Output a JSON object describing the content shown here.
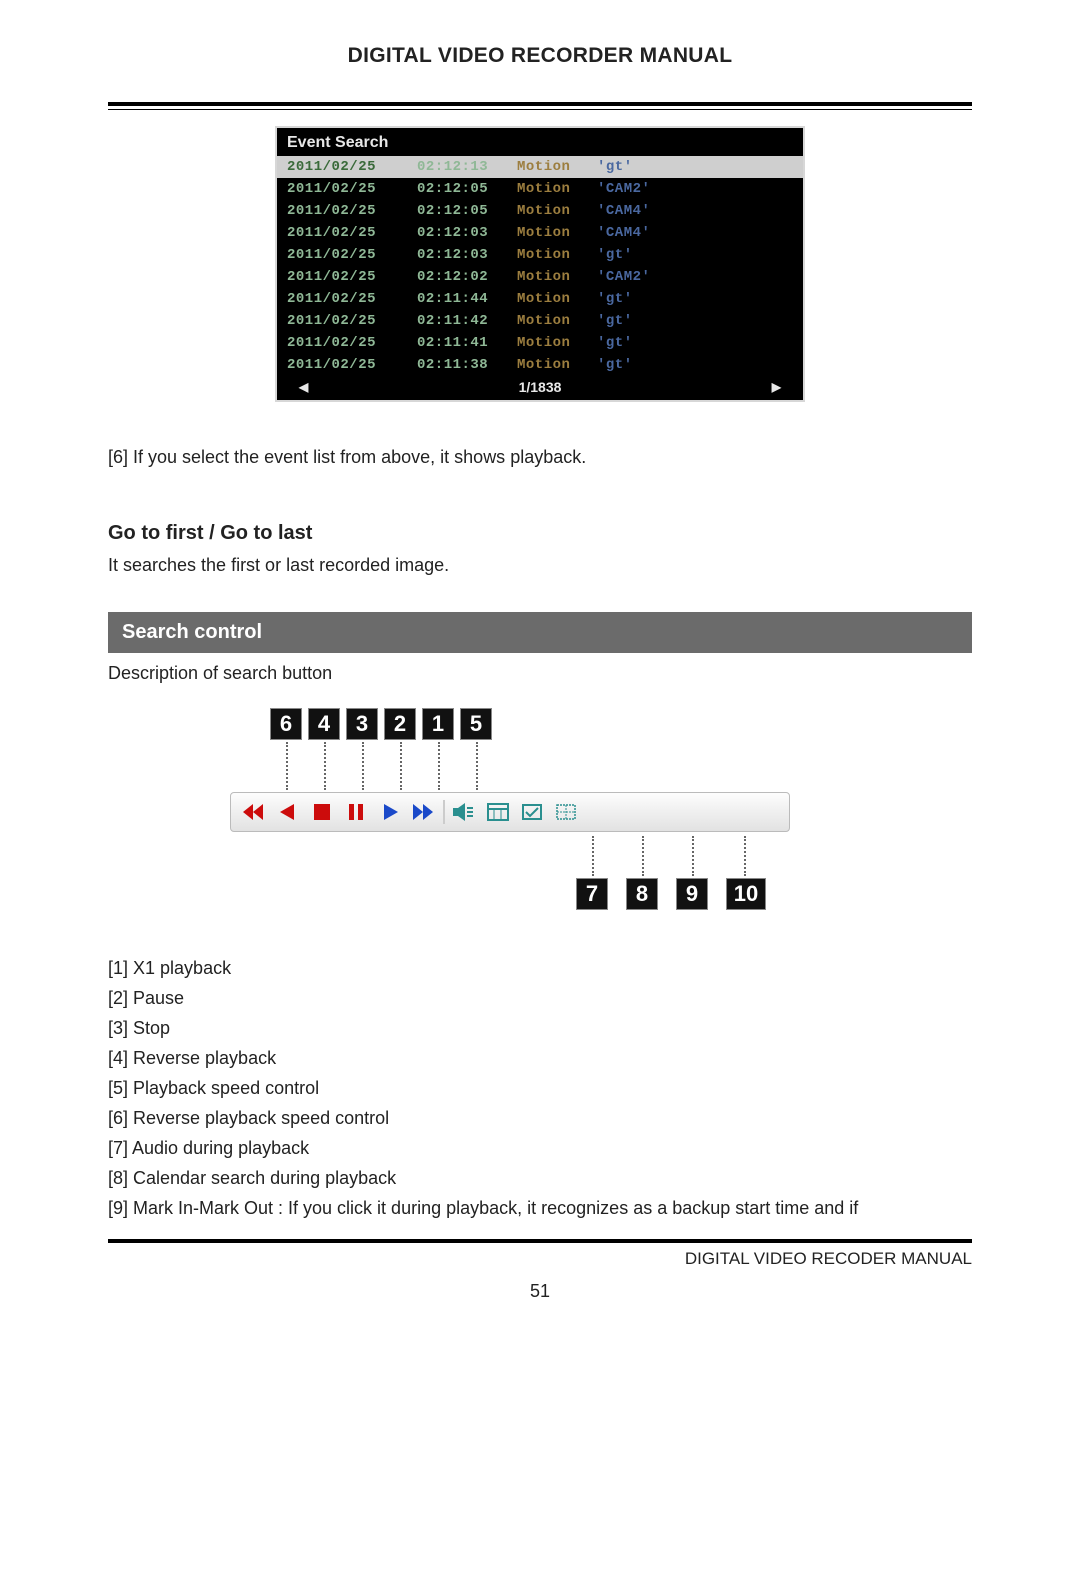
{
  "header": {
    "title": "DIGITAL VIDEO RECORDER MANUAL"
  },
  "event_box": {
    "title": "Event Search",
    "rows": [
      {
        "date": "2011/02/25",
        "time": "02:12:13",
        "type": "Motion",
        "cam": "'gt'",
        "selected": true
      },
      {
        "date": "2011/02/25",
        "time": "02:12:05",
        "type": "Motion",
        "cam": "'CAM2'",
        "selected": false
      },
      {
        "date": "2011/02/25",
        "time": "02:12:05",
        "type": "Motion",
        "cam": "'CAM4'",
        "selected": false
      },
      {
        "date": "2011/02/25",
        "time": "02:12:03",
        "type": "Motion",
        "cam": "'CAM4'",
        "selected": false
      },
      {
        "date": "2011/02/25",
        "time": "02:12:03",
        "type": "Motion",
        "cam": "'gt'",
        "selected": false
      },
      {
        "date": "2011/02/25",
        "time": "02:12:02",
        "type": "Motion",
        "cam": "'CAM2'",
        "selected": false
      },
      {
        "date": "2011/02/25",
        "time": "02:11:44",
        "type": "Motion",
        "cam": "'gt'",
        "selected": false
      },
      {
        "date": "2011/02/25",
        "time": "02:11:42",
        "type": "Motion",
        "cam": "'gt'",
        "selected": false
      },
      {
        "date": "2011/02/25",
        "time": "02:11:41",
        "type": "Motion",
        "cam": "'gt'",
        "selected": false
      },
      {
        "date": "2011/02/25",
        "time": "02:11:38",
        "type": "Motion",
        "cam": "'gt'",
        "selected": false
      }
    ],
    "pager_left": "◀",
    "pager_center": "1/1838",
    "pager_right": "▶"
  },
  "paragraphs": {
    "after_event": "[6] If you select the event list from above, it shows playback.",
    "gofirst_title": "Go to first / Go to last",
    "gofirst_text": "It searches the first or last recorded image."
  },
  "banner": {
    "label": "Search control"
  },
  "desc_line": "Description of search button",
  "diagram": {
    "labels": {
      "n6": "6",
      "n4": "4",
      "n3": "3",
      "n2": "2",
      "n1": "1",
      "n5": "5",
      "n7": "7",
      "n8": "8",
      "n9": "9",
      "n10": "10"
    }
  },
  "legend": [
    "[1] X1 playback",
    "[2] Pause",
    "[3] Stop",
    "[4] Reverse playback",
    "[5] Playback speed control",
    "[6] Reverse playback speed control",
    "[7] Audio during playback",
    "[8] Calendar search during playback",
    "[9] Mark In-Mark Out : If you click it during playback, it recognizes as a backup start time and if"
  ],
  "footer": {
    "right": "DIGITAL VIDEO RECODER MANUAL",
    "page": "51"
  }
}
